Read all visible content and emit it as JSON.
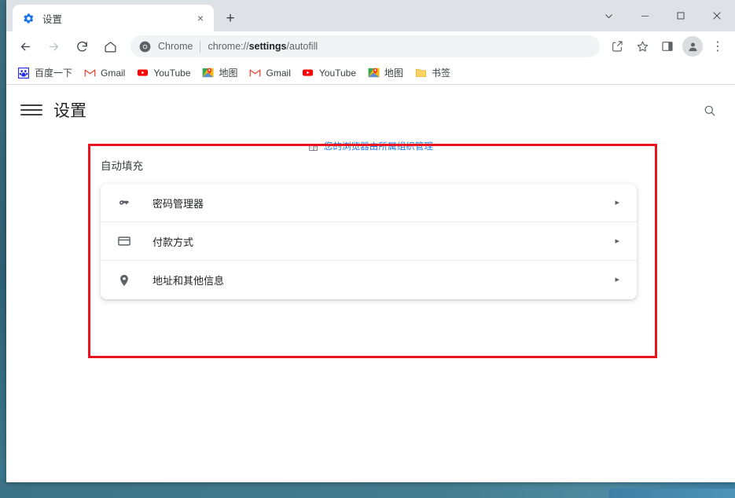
{
  "window": {
    "controls": [
      {
        "name": "tab-search-button",
        "glyph": "chevron-down"
      },
      {
        "name": "minimize-button",
        "glyph": "minimize"
      },
      {
        "name": "maximize-button",
        "glyph": "maximize"
      },
      {
        "name": "close-button",
        "glyph": "close"
      }
    ]
  },
  "tab_strip": {
    "active_tab": {
      "title": "设置",
      "favicon": "gear-icon",
      "close_label": "×"
    },
    "new_tab_label": "+"
  },
  "toolbar": {
    "back_label": "←",
    "forward_label": "→",
    "reload_label": "⟳",
    "home_label": "⌂",
    "omnibox": {
      "icon": "chrome-logo-icon",
      "chip_label": "Chrome",
      "url_prefix": "chrome://",
      "url_bold": "settings",
      "url_suffix": "/autofill",
      "full_url": "chrome://settings/autofill"
    },
    "share_label": "share-icon",
    "bookmark_star_label": "star-icon",
    "side_panel_label": "side-panel-icon",
    "profile_label": "profile-avatar-icon",
    "menu_label": "⋮"
  },
  "bookmarks": [
    {
      "label": "百度一下",
      "icon": "baidu-icon"
    },
    {
      "label": "Gmail",
      "icon": "gmail-icon"
    },
    {
      "label": "YouTube",
      "icon": "youtube-icon"
    },
    {
      "label": "地图",
      "icon": "maps-icon"
    },
    {
      "label": "Gmail",
      "icon": "gmail-icon"
    },
    {
      "label": "YouTube",
      "icon": "youtube-icon"
    },
    {
      "label": "地图",
      "icon": "maps-icon"
    },
    {
      "label": "书签",
      "icon": "folder-icon"
    }
  ],
  "settings": {
    "title": "设置",
    "search_icon": "search-icon",
    "menu_icon": "hamburger-icon",
    "managed_banner": {
      "text": "您的浏览器由所属组织管理",
      "icon": "building-icon",
      "color": "#1a73e8"
    },
    "autofill": {
      "section_title": "自动填充",
      "rows": [
        {
          "label": "密码管理器",
          "icon": "key-icon",
          "arrow": "▸"
        },
        {
          "label": "付款方式",
          "icon": "credit-card-icon",
          "arrow": "▸"
        },
        {
          "label": "地址和其他信息",
          "icon": "location-pin-icon",
          "arrow": "▸"
        }
      ]
    }
  },
  "annotation": {
    "color": "#e8141e",
    "shape": "rectangle"
  }
}
